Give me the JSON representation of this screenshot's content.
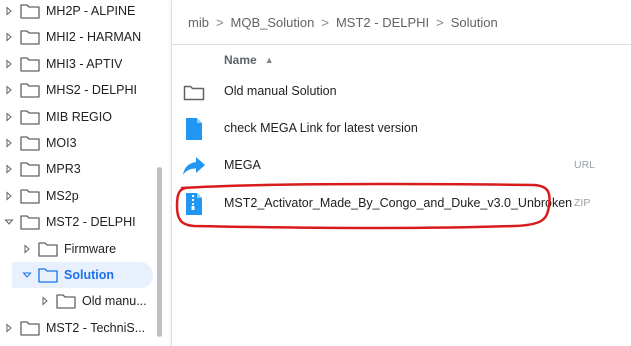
{
  "sidebar": {
    "items": [
      {
        "label": "MH2P - ALPINE",
        "level": 0,
        "chevron": "right"
      },
      {
        "label": "MHI2 - HARMAN",
        "level": 0,
        "chevron": "right"
      },
      {
        "label": "MHI3 - APTIV",
        "level": 0,
        "chevron": "right"
      },
      {
        "label": "MHS2 - DELPHI",
        "level": 0,
        "chevron": "right"
      },
      {
        "label": "MIB REGIO",
        "level": 0,
        "chevron": "right"
      },
      {
        "label": "MOI3",
        "level": 0,
        "chevron": "right"
      },
      {
        "label": "MPR3",
        "level": 0,
        "chevron": "right"
      },
      {
        "label": "MS2p",
        "level": 0,
        "chevron": "right"
      },
      {
        "label": "MST2 - DELPHI",
        "level": 0,
        "chevron": "down"
      },
      {
        "label": "Firmware",
        "level": 1,
        "chevron": "right"
      },
      {
        "label": "Solution",
        "level": 1,
        "chevron": "down",
        "selected": true
      },
      {
        "label": "Old manu...",
        "level": 2,
        "chevron": "right"
      },
      {
        "label": "MST2 - TechniS...",
        "level": 0,
        "chevron": "right"
      }
    ]
  },
  "breadcrumb": {
    "items": [
      "mib",
      "MQB_Solution",
      "MST2 - DELPHI",
      "Solution"
    ],
    "separator": ">"
  },
  "table": {
    "header_name": "Name",
    "sort_indicator": "▲",
    "rows": [
      {
        "icon": "folder-icon",
        "name": "Old manual Solution",
        "type": ""
      },
      {
        "icon": "document-icon",
        "name": "check MEGA Link for latest version",
        "type": ""
      },
      {
        "icon": "share-link-icon",
        "name": "MEGA",
        "type": "URL"
      },
      {
        "icon": "zip-file-icon",
        "name": "MST2_Activator_Made_By_Congo_and_Duke_v3.0_Unbroken",
        "type": "ZIP"
      }
    ]
  },
  "colors": {
    "accent": "#1a73e8",
    "folder_stroke": "#5f6368",
    "file_blue": "#2196f3",
    "annotation_red": "#d81b1b",
    "selected_bg": "#e8f0fe"
  }
}
